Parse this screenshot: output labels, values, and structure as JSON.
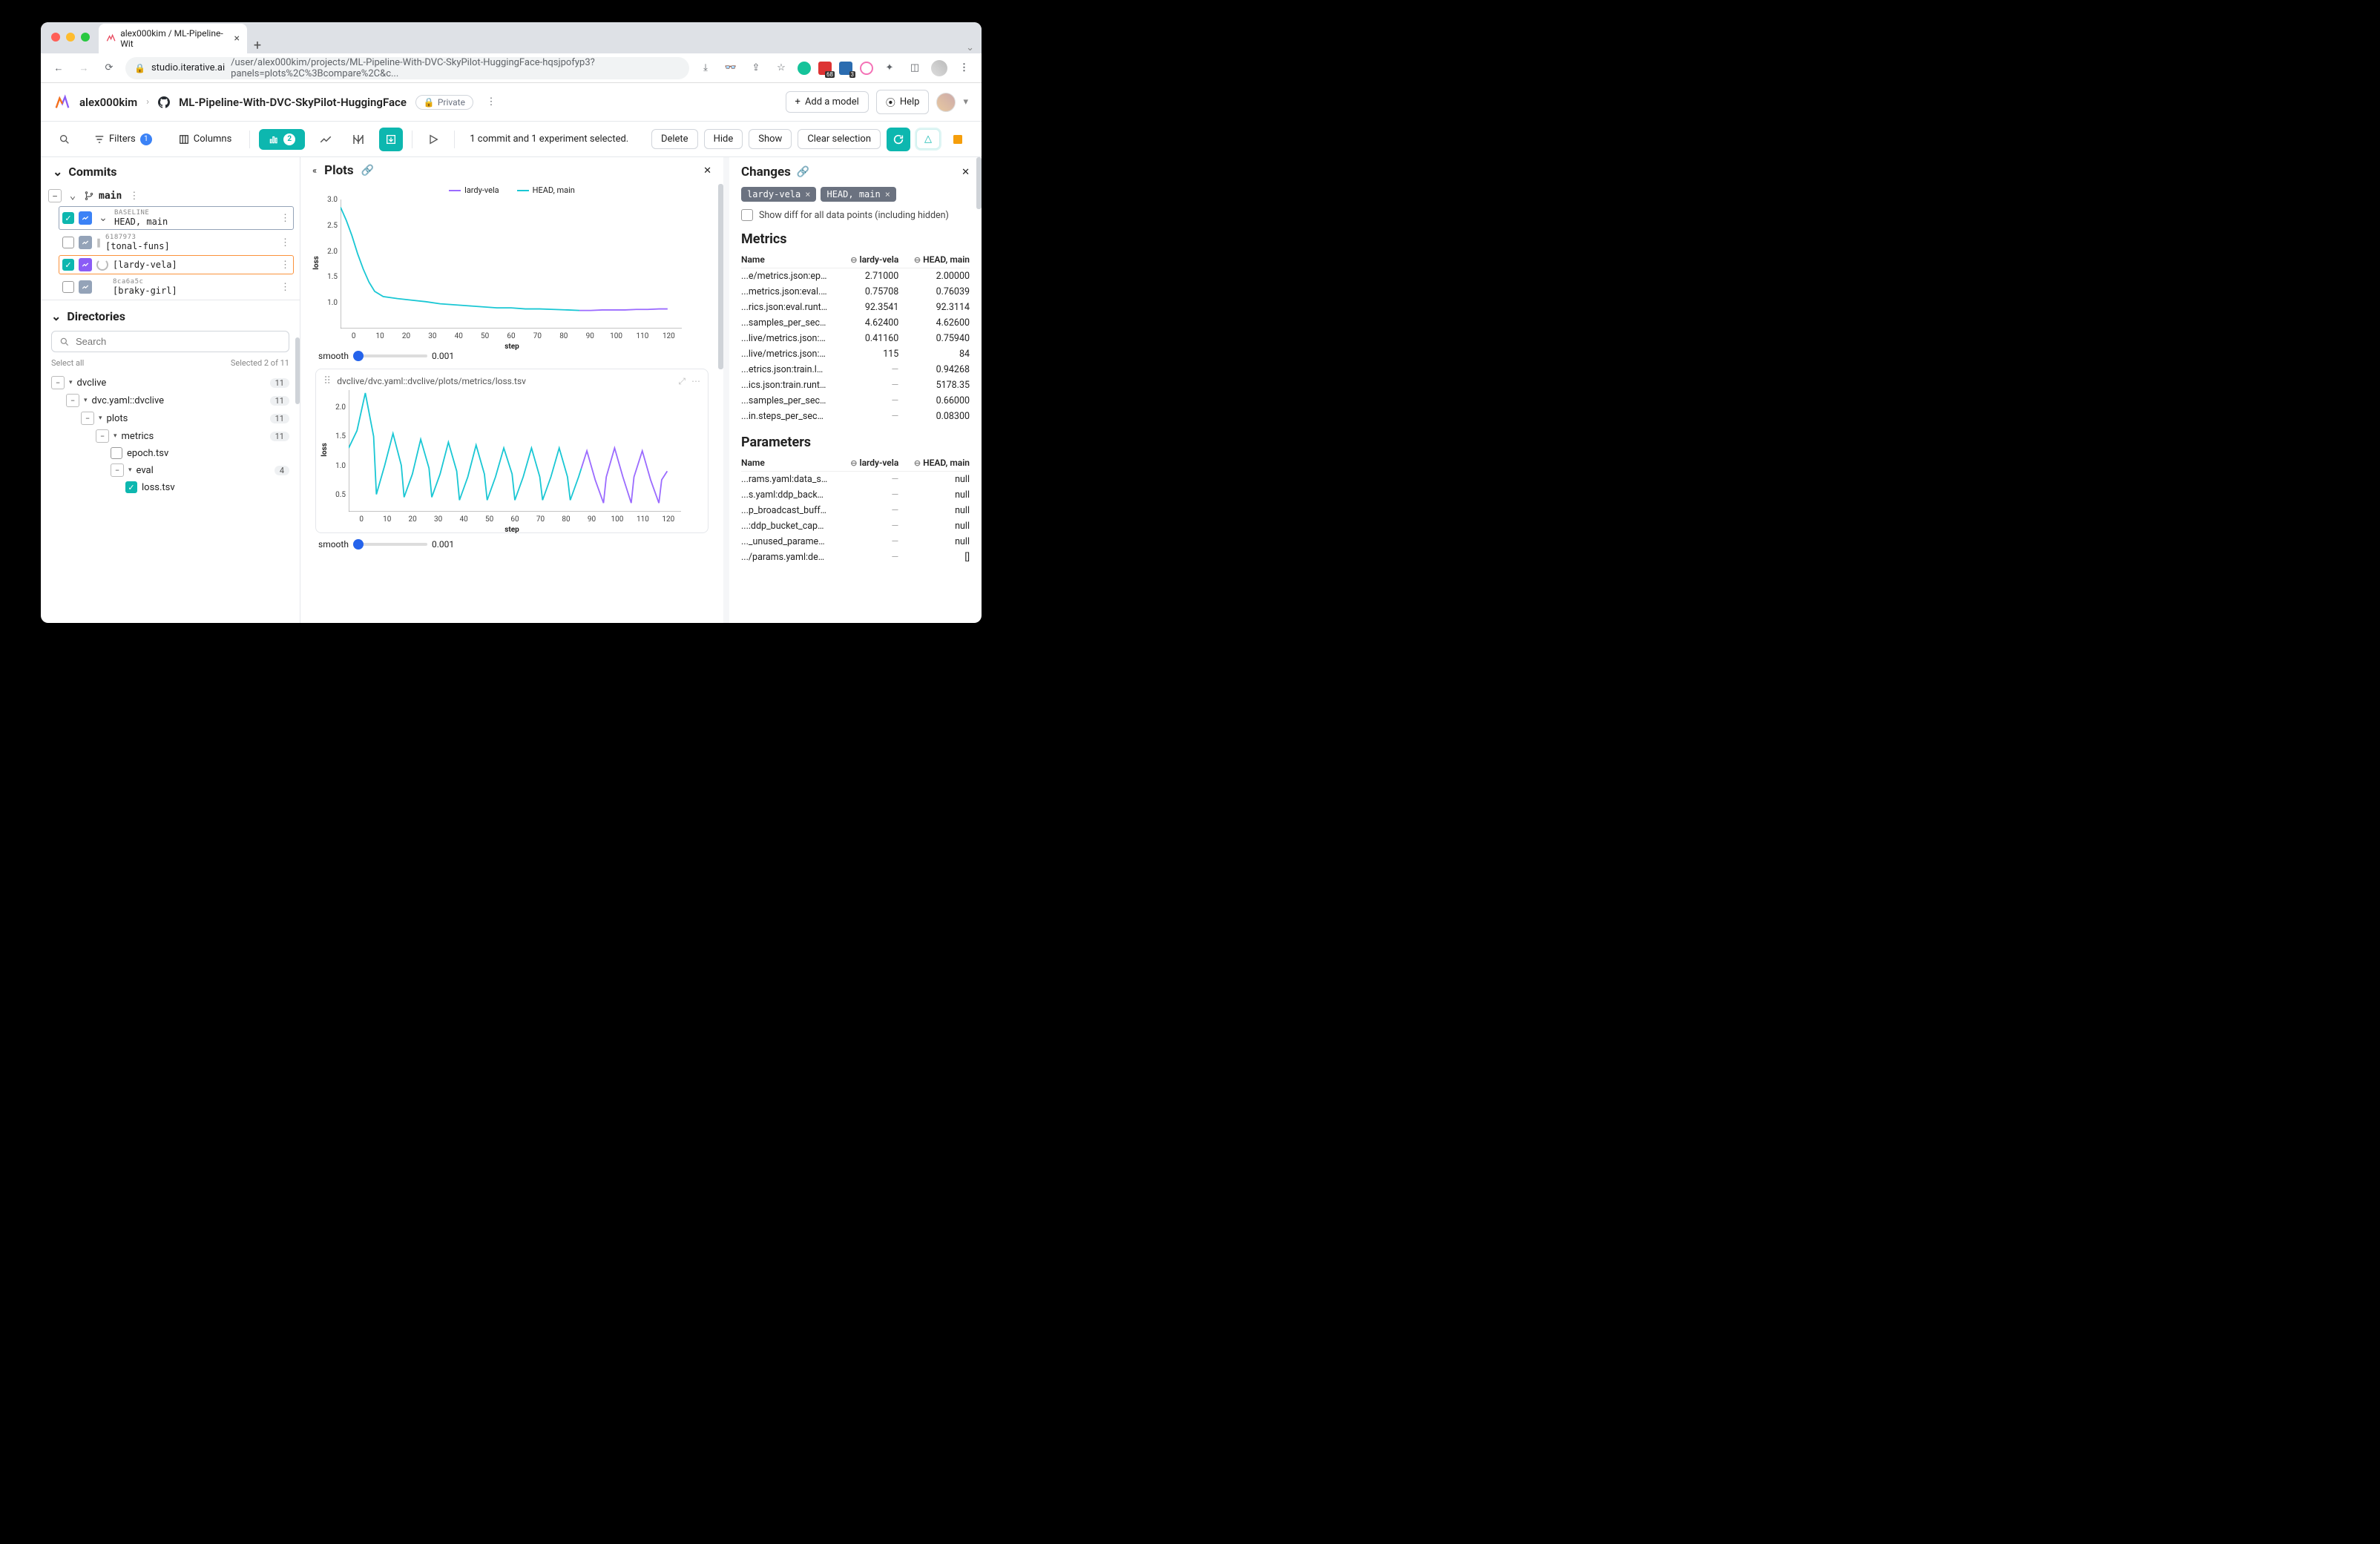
{
  "browser": {
    "tab_title": "alex000kim / ML-Pipeline-Wit",
    "url_host": "studio.iterative.ai",
    "url_path": "/user/alex000kim/projects/ML-Pipeline-With-DVC-SkyPilot-HuggingFace-hqsjpofyp3?panels=plots%2C%3Bcompare%2C&c...",
    "ext_badge_1": "68",
    "ext_badge_2": "3"
  },
  "header": {
    "user": "alex000kim",
    "repo": "ML-Pipeline-With-DVC-SkyPilot-HuggingFace",
    "privacy": "Private",
    "add_model": "Add a model",
    "help": "Help"
  },
  "toolbar": {
    "filters": "Filters",
    "filters_count": "1",
    "columns": "Columns",
    "chart_count": "2",
    "selection_msg": "1 commit and 1 experiment selected.",
    "delete": "Delete",
    "hide": "Hide",
    "show": "Show",
    "clear": "Clear selection"
  },
  "commits_panel": {
    "title": "Commits",
    "branch": "main",
    "rows": [
      {
        "top": "BASELINE",
        "label": "HEAD, main",
        "checked": true,
        "selected": "blue",
        "icon": "blue",
        "chev": true
      },
      {
        "top": "6187973",
        "label": "[tonal-funs]",
        "checked": false,
        "selected": "",
        "icon": "gray",
        "pause": true
      },
      {
        "top": "",
        "label": "[lardy-vela]",
        "checked": true,
        "selected": "orange",
        "icon": "purple",
        "spinner": true
      },
      {
        "top": "8ca6a5c",
        "label": "[braky-girl]",
        "checked": false,
        "selected": "",
        "icon": "gray"
      }
    ]
  },
  "directories": {
    "title": "Directories",
    "search_placeholder": "Search",
    "select_all": "Select all",
    "selected": "Selected 2 of 11",
    "tree": {
      "n1": {
        "label": "dvclive",
        "count": "11"
      },
      "n2": {
        "label": "dvc.yaml::dvclive",
        "count": "11"
      },
      "n3": {
        "label": "plots",
        "count": "11"
      },
      "n4": {
        "label": "metrics",
        "count": "11"
      },
      "n5": {
        "label": "epoch.tsv"
      },
      "n6": {
        "label": "eval",
        "count": "4"
      },
      "n7": {
        "label": "loss.tsv"
      }
    }
  },
  "plots": {
    "title": "Plots",
    "legend_a": "lardy-vela",
    "legend_b": "HEAD, main",
    "color_a": "#9b6bff",
    "color_b": "#1ac7d4",
    "smooth_label": "smooth",
    "smooth_val": "0.001",
    "plot2_path": "dvclive/dvc.yaml::dvclive/plots/metrics/loss.tsv",
    "ylabel": "loss",
    "xlabel": "step"
  },
  "chart_data": [
    {
      "type": "line",
      "xlabel": "step",
      "ylabel": "loss",
      "xlim": [
        0,
        120
      ],
      "ylim": [
        0.5,
        3.0
      ],
      "xticks": [
        0,
        10,
        20,
        30,
        40,
        50,
        60,
        70,
        80,
        90,
        100,
        110,
        120
      ],
      "yticks": [
        1.0,
        1.5,
        2.0,
        2.5,
        3.0
      ],
      "series": [
        {
          "name": "HEAD, main",
          "color": "#1ac7d4",
          "x": [
            0,
            2,
            4,
            6,
            8,
            10,
            12,
            15,
            20,
            25,
            30,
            35,
            40,
            45,
            50,
            55,
            60,
            65,
            70,
            75,
            80,
            84
          ],
          "y": [
            2.85,
            2.6,
            2.3,
            1.95,
            1.65,
            1.4,
            1.22,
            1.12,
            1.08,
            1.05,
            1.02,
            0.98,
            0.96,
            0.94,
            0.92,
            0.9,
            0.9,
            0.88,
            0.88,
            0.87,
            0.86,
            0.85
          ]
        },
        {
          "name": "lardy-vela",
          "color": "#9b6bff",
          "x": [
            84,
            88,
            92,
            96,
            100,
            104,
            108,
            112,
            115
          ],
          "y": [
            0.85,
            0.85,
            0.86,
            0.86,
            0.86,
            0.87,
            0.87,
            0.88,
            0.88
          ]
        }
      ]
    },
    {
      "type": "line",
      "title": "dvclive/dvc.yaml::dvclive/plots/metrics/loss.tsv",
      "xlabel": "step",
      "ylabel": "loss",
      "xlim": [
        0,
        120
      ],
      "ylim": [
        0.2,
        2.3
      ],
      "xticks": [
        0,
        10,
        20,
        30,
        40,
        50,
        60,
        70,
        80,
        90,
        100,
        110,
        120
      ],
      "yticks": [
        0.5,
        1.0,
        1.5,
        2.0
      ],
      "series": [
        {
          "name": "HEAD, main",
          "color": "#1ac7d4",
          "x": [
            0,
            3,
            6,
            9,
            10,
            13,
            16,
            19,
            20,
            23,
            26,
            29,
            30,
            33,
            36,
            39,
            40,
            43,
            46,
            49,
            50,
            53,
            56,
            59,
            60,
            63,
            66,
            69,
            70,
            73,
            76,
            79,
            80,
            83,
            84
          ],
          "y": [
            1.3,
            1.6,
            2.25,
            1.5,
            0.5,
            1.0,
            1.55,
            1.0,
            0.45,
            0.85,
            1.45,
            0.95,
            0.45,
            0.85,
            1.4,
            0.9,
            0.4,
            0.8,
            1.35,
            0.85,
            0.4,
            0.8,
            1.3,
            0.85,
            0.4,
            0.8,
            1.3,
            0.8,
            0.4,
            0.8,
            1.3,
            0.8,
            0.4,
            0.8,
            0.95
          ]
        },
        {
          "name": "lardy-vela",
          "color": "#9b6bff",
          "x": [
            84,
            86,
            89,
            92,
            93,
            96,
            99,
            102,
            103,
            106,
            109,
            112,
            113,
            115
          ],
          "y": [
            0.95,
            1.25,
            0.75,
            0.35,
            0.8,
            1.3,
            0.8,
            0.35,
            0.8,
            1.25,
            0.75,
            0.35,
            0.75,
            0.9
          ]
        }
      ]
    }
  ],
  "changes": {
    "title": "Changes",
    "tag_a": "lardy-vela",
    "tag_b": "HEAD, main",
    "diff_label": "Show diff for all data points (including hidden)",
    "metrics_head": "Metrics",
    "params_head": "Parameters",
    "col_name": "Name",
    "col_a": "lardy-vela",
    "col_b": "HEAD, main",
    "metrics": [
      {
        "name": "...e/metrics.json:epoch",
        "a": "2.71000",
        "b": "2.00000"
      },
      {
        "name": "...metrics.json:eval.loss",
        "a": "0.75708",
        "b": "0.76039"
      },
      {
        "name": "...rics.json:eval.runtime",
        "a": "92.3541",
        "b": "92.3114"
      },
      {
        "name": "...samples_per_second",
        "a": "4.62400",
        "b": "4.62600"
      },
      {
        "name": "...live/metrics.json:loss",
        "a": "0.41160",
        "b": "0.75940"
      },
      {
        "name": "...live/metrics.json:step",
        "a": "115",
        "b": "84"
      },
      {
        "name": "...etrics.json:train.loss",
        "a": "—",
        "b": "0.94268"
      },
      {
        "name": "...ics.json:train.runtime",
        "a": "—",
        "b": "5178.35"
      },
      {
        "name": "...samples_per_second",
        "a": "—",
        "b": "0.66000"
      },
      {
        "name": "...in.steps_per_second",
        "a": "—",
        "b": "0.08300"
      }
    ],
    "params": [
      {
        "name": "...rams.yaml:data_seed",
        "a": "—",
        "b": "null"
      },
      {
        "name": "...s.yaml:ddp_backend",
        "a": "—",
        "b": "null"
      },
      {
        "name": "...p_broadcast_buffers",
        "a": "—",
        "b": "null"
      },
      {
        "name": "...:ddp_bucket_cap_mb",
        "a": "—",
        "b": "null"
      },
      {
        "name": "..._unused_parameters",
        "a": "—",
        "b": "null"
      },
      {
        "name": ".../params.yaml:debug",
        "a": "—",
        "b": "[]"
      }
    ]
  }
}
